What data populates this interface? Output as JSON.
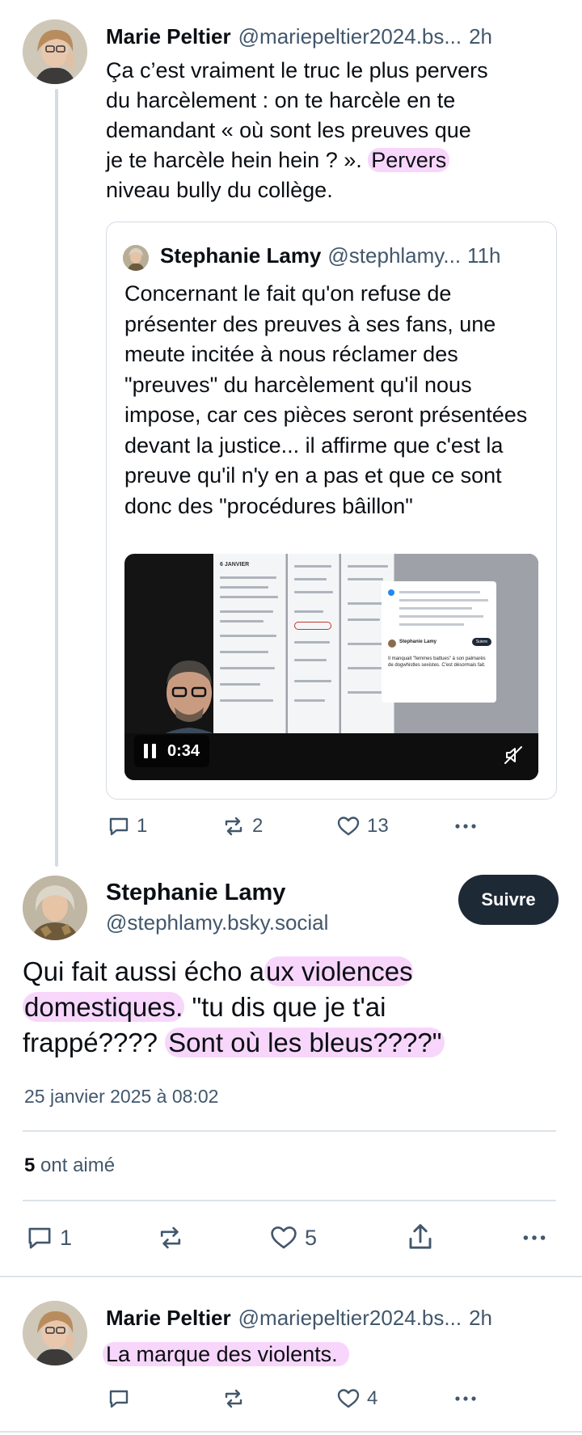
{
  "colors": {
    "highlight": "#f6c8fa",
    "follow_bg": "#1e2936",
    "muted": "#42576c",
    "divider": "#dde3e9"
  },
  "post1": {
    "author": "Marie Peltier",
    "handle": "@mariepeltier2024.bs...",
    "time": "2h",
    "text_line1": "Ça c’est vraiment le truc le plus pervers",
    "text_line2": "du harcèlement : on te harcèle en te",
    "text_line3": "demandant « où sont les preuves que",
    "text_line4a": "je te harcèle hein hein ? ». ",
    "text_line4b": "Pervers",
    "text_line5": "niveau bully du collège.",
    "quote": {
      "author": "Stephanie Lamy",
      "handle": "@stephlamy...",
      "time": "11h",
      "text": "Concernant le fait qu'on refuse de présenter des preuves à ses fans, une meute incitée à nous réclamer des \"preuves\" du harcèlement qu'il nous impose, car ces pièces seront présentées devant la justice... il affirme que c'est la preuve qu'il n'y en a pas et que ce sont donc des \"procédures bâillon\"",
      "video": {
        "duration": "0:34",
        "slide_heading": "6 JANVIER",
        "popup_name": "Stephanie Lamy",
        "popup_text": "Il manquait \"femmes battues\" à son palmarès de dogwhistles sexistes. C'est désormais fait.",
        "follow_label": "Suivre"
      }
    },
    "actions": {
      "replies": "1",
      "reposts": "2",
      "likes": "13"
    }
  },
  "main": {
    "author": "Stephanie Lamy",
    "handle": "@stephlamy.bsky.social",
    "follow_label": "Suivre",
    "text_a": "Qui fait aussi écho a",
    "text_b": "ux violences",
    "text_c": "domestiques.",
    "text_d": " \"tu dis que je t'ai",
    "text_e": "frappé???? ",
    "text_f": "Sont où les bleus????\"",
    "date": "25 janvier 2025 à 08:02",
    "likes_count": "5",
    "likes_label": "ont aimé",
    "actions": {
      "replies": "1",
      "likes": "5"
    }
  },
  "reply": {
    "author": "Marie Peltier",
    "handle": "@mariepeltier2024.bs...",
    "time": "2h",
    "text": "La marque des violents.",
    "actions": {
      "likes": "4"
    }
  },
  "icons": [
    "reply-icon",
    "repost-icon",
    "heart-icon",
    "more-icon",
    "share-icon",
    "pause-icon",
    "mute-icon"
  ]
}
